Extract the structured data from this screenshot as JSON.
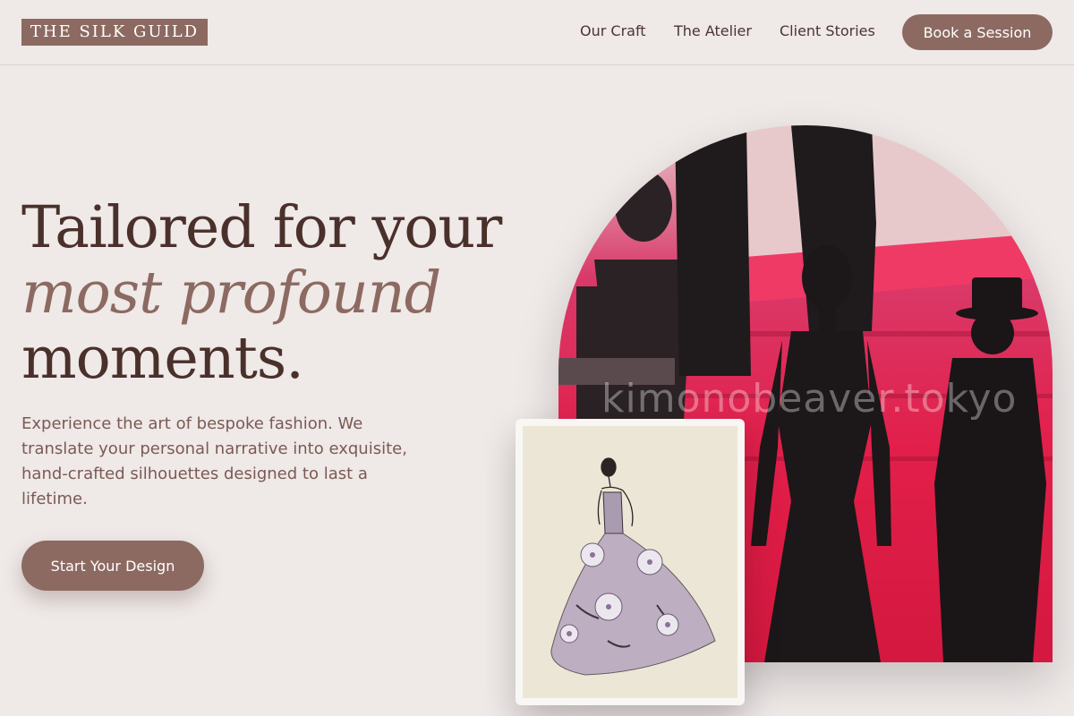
{
  "brand": {
    "name": "THE SILK GUILD"
  },
  "nav": {
    "items": [
      "Our Craft",
      "The Atelier",
      "Client Stories"
    ],
    "cta_label": "Book a Session"
  },
  "hero": {
    "headline_line1": "Tailored for your",
    "headline_line2": "most profound",
    "headline_line3": "moments.",
    "subcopy": "Experience the art of bespoke fashion. We translate your personal narrative into exquisite, hand-crafted silhouettes designed to last a lifetime.",
    "cta_label": "Start Your Design"
  },
  "images": {
    "arch_watermark": "kimonobeaver.tokyo"
  },
  "colors": {
    "background": "#efe9e8",
    "accent": "#8c6a61",
    "heading": "#4a302b",
    "arch_wall": "#e21f4a"
  }
}
